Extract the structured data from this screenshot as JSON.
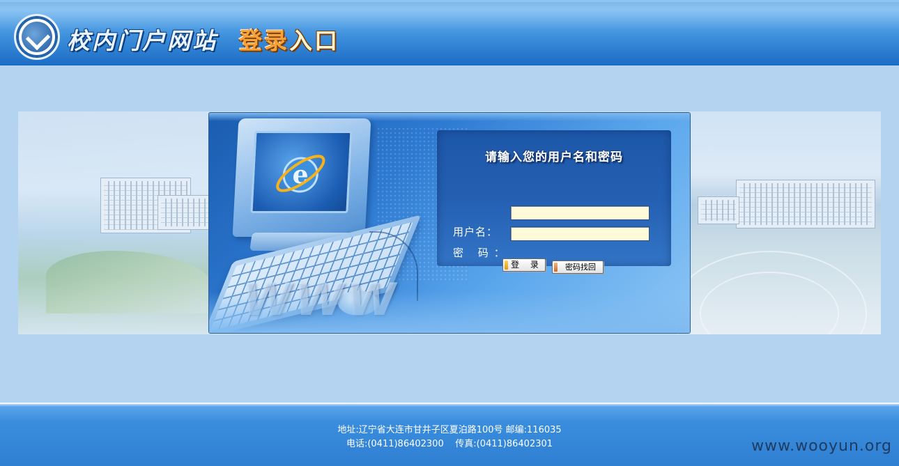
{
  "header": {
    "title": "校内门户网站",
    "subtitle_part1": "登录",
    "subtitle_part2": "入口"
  },
  "login": {
    "prompt": "请输入您的用户名和密码",
    "username_label": "用户名：",
    "password_label": "密 码：",
    "username_value": "",
    "password_value": "",
    "login_button": "登 录",
    "recover_button": "密码找回"
  },
  "illustration": {
    "text": "WWW"
  },
  "footer": {
    "address_line": "地址:辽宁省大连市甘井子区夏泊路100号 邮编:116035",
    "contact_line": "电话:(0411)86402300    传真:(0411)86402301"
  },
  "watermark": "www.wooyun.org",
  "colors": {
    "header_blue": "#3d8fdc",
    "page_bg": "#b4d3f0",
    "input_bg": "#fffbd8",
    "subtitle_orange": "#f5a23a"
  }
}
